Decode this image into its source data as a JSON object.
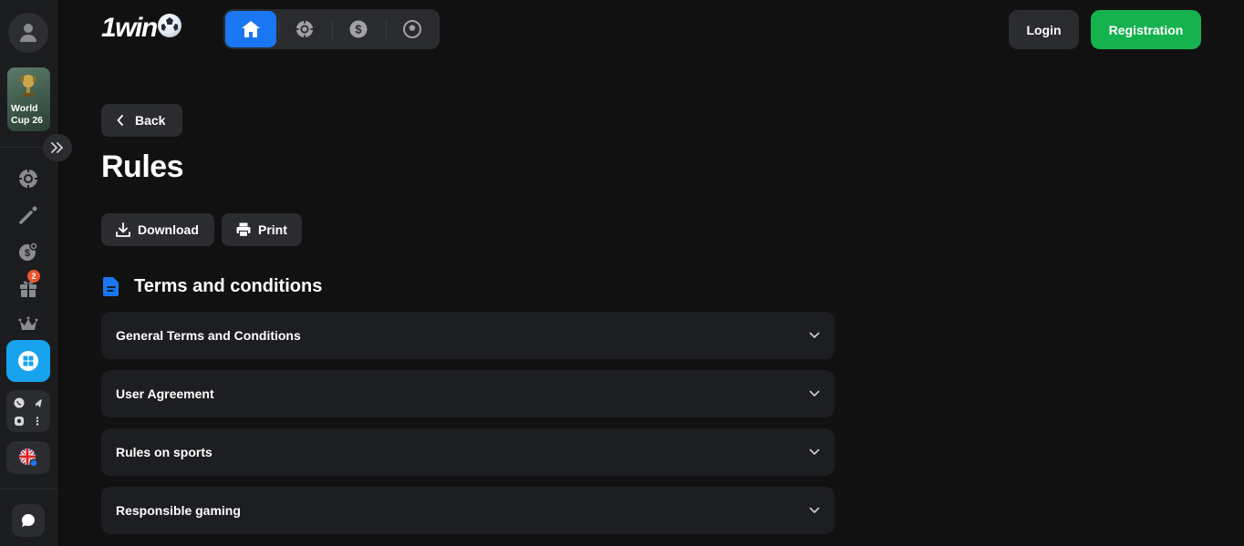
{
  "sidebar": {
    "promo_label": "World Cup 26",
    "badge_count": "2"
  },
  "header": {
    "logo_text": "1win",
    "login_label": "Login",
    "registration_label": "Registration"
  },
  "main": {
    "back_label": "Back",
    "page_title": "Rules",
    "download_label": "Download",
    "print_label": "Print",
    "section_title": "Terms and conditions",
    "accordion": [
      {
        "label": "General Terms and Conditions"
      },
      {
        "label": "User Agreement"
      },
      {
        "label": "Rules on sports"
      },
      {
        "label": "Responsible gaming"
      }
    ]
  },
  "colors": {
    "accent_blue": "#1a76f2",
    "registration_green": "#16b24f",
    "app_blue": "#17a3ee",
    "badge_orange": "#e8552c"
  }
}
